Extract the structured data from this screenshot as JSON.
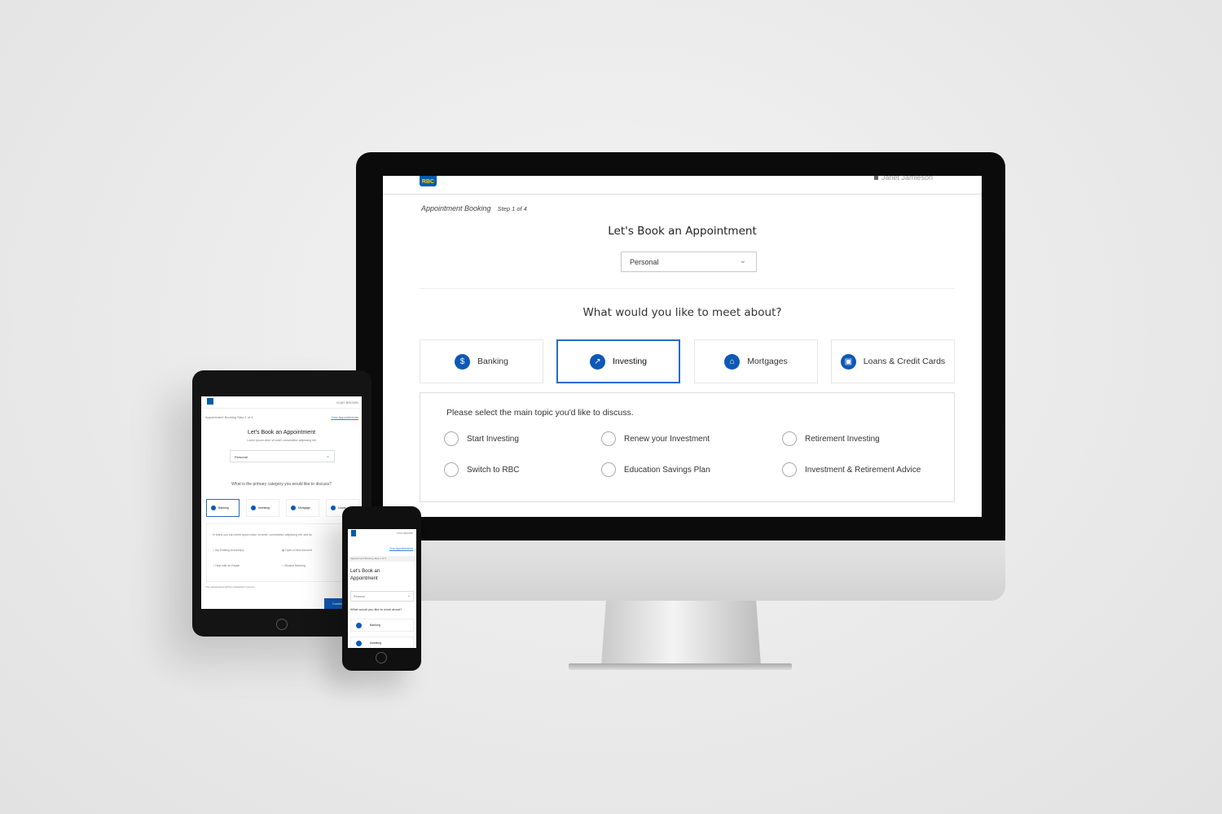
{
  "desktop": {
    "header": {
      "logo": "RBC",
      "user_name": "Janet Jamieson"
    },
    "breadcrumb": {
      "label": "Appointment Booking",
      "step": "Step 1 of 4"
    },
    "title": "Let's Book an Appointment",
    "account_type_select": {
      "value": "Personal"
    },
    "question": "What would you like to meet about?",
    "categories": [
      {
        "label": "Banking",
        "icon": "dollar-icon",
        "glyph": "$",
        "selected": false
      },
      {
        "label": "Investing",
        "icon": "trend-icon",
        "glyph": "↗",
        "selected": true
      },
      {
        "label": "Mortgages",
        "icon": "house-icon",
        "glyph": "⌂",
        "selected": false
      },
      {
        "label": "Loans & Credit Cards",
        "icon": "card-icon",
        "glyph": "▣",
        "selected": false
      }
    ],
    "topics": {
      "prompt": "Please select the main topic you'd like to discuss.",
      "options": [
        "Start Investing",
        "Renew your Investment",
        "Retirement Investing",
        "Switch to RBC",
        "Education Savings Plan",
        "Investment & Retirement  Advice"
      ]
    },
    "colors": {
      "accent": "#0d59b5",
      "selected_border": "#2a6bbf"
    }
  },
  "tablet": {
    "user_name": "VIJAY BROWN",
    "breadcrumb": "Appointment Booking Step 1 of 4",
    "link": "Your Appointments",
    "title": "Let's Book an Appointment",
    "subtitle": "Lorem ipsum dolor sit amet, consectetur adipiscing elit",
    "select_value": "Personal",
    "question": "What is the primary category you would like to discuss?",
    "categories": [
      "Banking",
      "Investing",
      "Mortgage",
      "Loans"
    ],
    "intro": "In loans you can lorem ipsum dolor sit amet, consectetur adipiscing elit, sed do",
    "options": [
      "My Existing Account(s)",
      "Open a New Account",
      "Help with an Estate",
      "Student Banking"
    ],
    "note": "Your appointment will be conducted in person.",
    "continue_button": "Continue"
  },
  "phone": {
    "user_name": "VIJAY BROWN",
    "link": "Your Appointments",
    "breadcrumb": "Appointment Booking Step 1 of 4",
    "title": "Let's Book an Appointment",
    "select_value": "Personal",
    "question": "What would you like to meet about?",
    "categories": [
      "Banking",
      "Investing"
    ]
  }
}
